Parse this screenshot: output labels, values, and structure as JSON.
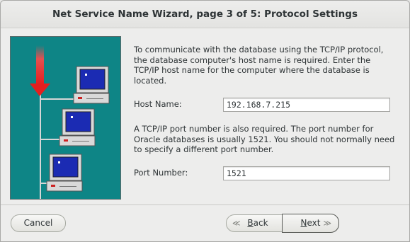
{
  "window": {
    "title": "Net Service Name Wizard, page 3 of 5: Protocol Settings"
  },
  "content": {
    "intro_text": "To communicate with the database using the TCP/IP protocol, the database computer's host name is required.  Enter the TCP/IP host name for the computer where the database is located.",
    "host_label": "Host Name:",
    "host_value": "192.168.7.215",
    "port_text": "A TCP/IP port number is also required.  The port number for Oracle databases is usually 1521.  You should not normally need to specify a different port number.",
    "port_label": "Port Number:",
    "port_value": "1521"
  },
  "buttons": {
    "cancel": "Cancel",
    "back_accel": "B",
    "back_rest": "ack",
    "next_accel": "N",
    "next_rest": "ext"
  },
  "icons": {
    "back": "chevron-left-double-icon",
    "next": "chevron-right-double-icon",
    "illustration": "network-computers-illustration"
  },
  "colors": {
    "illustration_bg": "#0e8586",
    "arrow": "#e51f1f",
    "screen": "#1b2bb3"
  }
}
